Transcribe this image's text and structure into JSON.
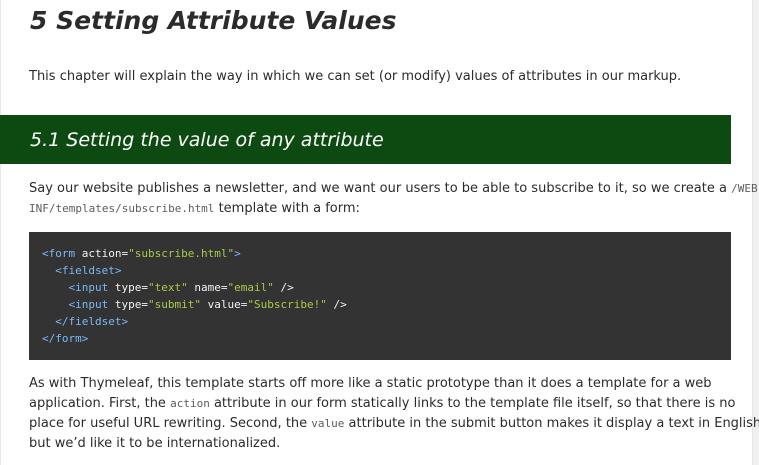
{
  "chapter": {
    "title": "5 Setting Attribute Values",
    "intro": "This chapter will explain the way in which we can set (or modify) values of attributes in our markup."
  },
  "section": {
    "title": "5.1 Setting the value of any attribute",
    "band_color": "#0d4a12"
  },
  "paragraph1": {
    "line1_text": "Say our website publishes a newsletter, and we want our users to be able to subscribe to it, so we create a ",
    "line1_code": "/WEB-",
    "line2_code": "INF/templates/subscribe.html",
    "line2_text": " template with a form:"
  },
  "code": {
    "lines": [
      {
        "indent": "",
        "open": "<",
        "tag": "form",
        "attrs": [
          {
            "name": "action",
            "value": "\"subscribe.html\""
          }
        ],
        "close": ">"
      },
      {
        "indent": "  ",
        "open": "<",
        "tag": "fieldset",
        "attrs": [],
        "close": ">"
      },
      {
        "indent": "    ",
        "open": "<",
        "tag": "input",
        "attrs": [
          {
            "name": "type",
            "value": "\"text\""
          },
          {
            "name": "name",
            "value": "\"email\""
          }
        ],
        "close": " />"
      },
      {
        "indent": "    ",
        "open": "<",
        "tag": "input",
        "attrs": [
          {
            "name": "type",
            "value": "\"submit\""
          },
          {
            "name": "value",
            "value": "\"Subscribe!\""
          }
        ],
        "close": " />"
      },
      {
        "indent": "  ",
        "open": "</",
        "tag": "fieldset",
        "attrs": [],
        "close": ">"
      },
      {
        "indent": "",
        "open": "</",
        "tag": "form",
        "attrs": [],
        "close": ">"
      }
    ],
    "colors": {
      "background": "#333333",
      "tag": "#7ab8f5",
      "string": "#a8c94a",
      "text": "#f2f2f2"
    }
  },
  "paragraph2": {
    "line1": "As with Thymeleaf, this template starts off more like a static prototype than it does a template for a web",
    "line2_a": "application. First, the ",
    "line2_code": "action",
    "line2_b": " attribute in our form statically links to the template file itself, so that there is no",
    "line3_a": "place for useful URL rewriting. Second, the ",
    "line3_code": "value",
    "line3_b": " attribute in the submit button makes it display a text in English,",
    "line4": "but we’d like it to be internationalized."
  }
}
